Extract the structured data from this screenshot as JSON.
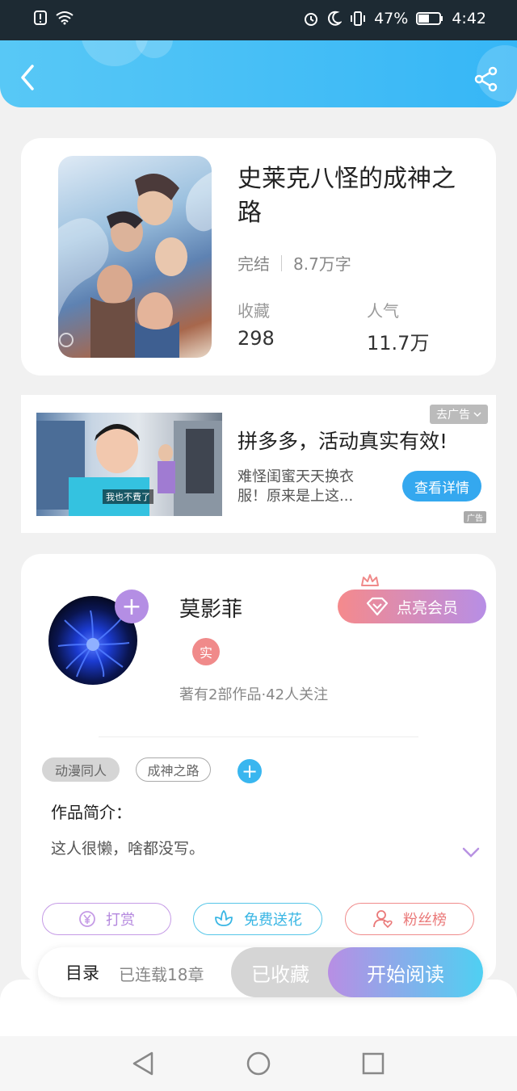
{
  "status_bar": {
    "battery": "47%",
    "time": "4:42",
    "icons": [
      "alert-icon",
      "wifi-icon",
      "alarm-icon",
      "moon-icon",
      "vibrate-icon",
      "battery-icon"
    ]
  },
  "header": {
    "back_icon": "chevron-left-icon",
    "share_icon": "share-icon"
  },
  "book": {
    "title": "史莱克八怪的成神之路",
    "status": "完结",
    "word_count": "8.7万字",
    "collect_label": "收藏",
    "collect_value": "298",
    "popularity_label": "人气",
    "popularity_value": "11.7万"
  },
  "ad": {
    "remove_label": "去广告",
    "title": "拼多多，活动真实有效!",
    "description": "难怪闺蜜天天换衣服！原来是上这...",
    "button": "查看详情",
    "image_caption": "我也不費了",
    "ad_mark": "广告"
  },
  "author": {
    "name": "莫影菲",
    "badge": "实",
    "summary": "著有2部作品·42人关注",
    "vip_button": "点亮会员"
  },
  "tags": [
    "动漫同人",
    "成神之路"
  ],
  "intro": {
    "label": "作品简介：",
    "text": "这人很懒，啥都没写。"
  },
  "actions": {
    "reward": "打赏",
    "flower": "免费送花",
    "fans": "粉丝榜"
  },
  "bottom_bar": {
    "catalog": "目录",
    "serial_status": "已连载18章",
    "collected": "已收藏",
    "start_read": "开始阅读"
  },
  "colors": {
    "header_blue": "#36b6f6",
    "accent_purple": "#b48ee4",
    "accent_cyan": "#39b6ef",
    "accent_red": "#f08a8a"
  }
}
